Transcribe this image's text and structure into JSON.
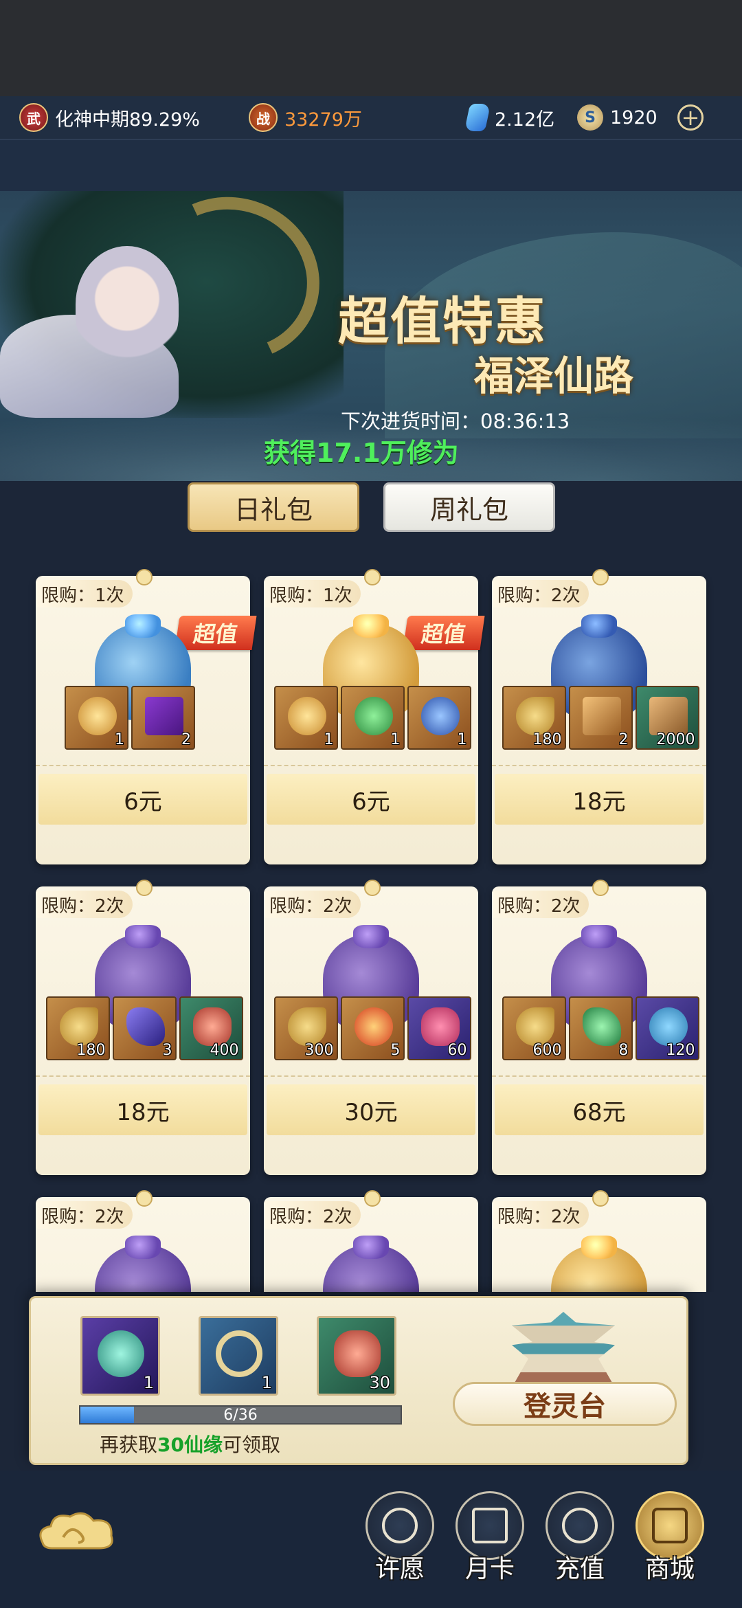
{
  "topbar": {
    "realm_badge": "武",
    "realm": "化神中期89.29%",
    "power_badge": "战",
    "power": "33279万",
    "spirit_stones": "2.12亿",
    "coin_symbol": "S",
    "coins": "1920",
    "add_symbol": "+"
  },
  "banner": {
    "title_line1": "超值特惠",
    "title_line2": "福泽仙路",
    "restock_label": "下次进货时间：",
    "restock_time": "08:36:13",
    "gain_text": "获得17.1万修为"
  },
  "tabs": [
    {
      "label": "日礼包",
      "active": true
    },
    {
      "label": "周礼包",
      "active": false
    }
  ],
  "packs": [
    {
      "limit": "限购：1次",
      "tag": "超值",
      "price": "6元",
      "items": [
        {
          "icon": "gift-bag-icon",
          "count": "1"
        },
        {
          "icon": "talisman-scroll-icon",
          "count": "2"
        }
      ]
    },
    {
      "limit": "限购：1次",
      "tag": "超值",
      "price": "6元",
      "items": [
        {
          "icon": "gift-bag-icon",
          "count": "1"
        },
        {
          "icon": "green-potion-icon",
          "count": "1"
        },
        {
          "icon": "blue-potion-icon",
          "count": "1"
        }
      ]
    },
    {
      "limit": "限购：2次",
      "tag": "",
      "price": "18元",
      "items": [
        {
          "icon": "crescent-token-icon",
          "count": "180"
        },
        {
          "icon": "tablet-icon",
          "count": "2"
        },
        {
          "icon": "scroll-bundle-icon",
          "count": "2000"
        }
      ]
    },
    {
      "limit": "限购：2次",
      "tag": "",
      "price": "18元",
      "items": [
        {
          "icon": "crescent-token-icon",
          "count": "180"
        },
        {
          "icon": "purple-crystal-icon",
          "count": "3"
        },
        {
          "icon": "red-ore-icon",
          "count": "400"
        }
      ]
    },
    {
      "limit": "限购：2次",
      "tag": "",
      "price": "30元",
      "items": [
        {
          "icon": "crescent-token-icon",
          "count": "300"
        },
        {
          "icon": "fire-orb-icon",
          "count": "5"
        },
        {
          "icon": "pouch-icon",
          "count": "60"
        }
      ]
    },
    {
      "limit": "限购：2次",
      "tag": "",
      "price": "68元",
      "items": [
        {
          "icon": "crescent-token-icon",
          "count": "600"
        },
        {
          "icon": "jade-pendant-icon",
          "count": "8"
        },
        {
          "icon": "spirit-beast-icon",
          "count": "120"
        }
      ]
    },
    {
      "limit": "限购：2次",
      "tag": "",
      "price": "",
      "items": []
    },
    {
      "limit": "限购：2次",
      "tag": "",
      "price": "",
      "items": []
    },
    {
      "limit": "限购：2次",
      "tag": "",
      "price": "",
      "items": []
    }
  ],
  "reward_panel": {
    "rewards": [
      {
        "icon": "spirit-pet-icon",
        "count": "1"
      },
      {
        "icon": "jade-ring-icon",
        "count": "1"
      },
      {
        "icon": "red-ore-icon",
        "count": "30"
      }
    ],
    "progress_text": "6/36",
    "progress_fraction": 0.1667,
    "hint_prefix": "再获取",
    "hint_amount": "30仙缘",
    "hint_suffix": "可领取",
    "altar_button": "登灵台"
  },
  "nav": [
    {
      "label": "许愿",
      "active": false
    },
    {
      "label": "月卡",
      "active": false
    },
    {
      "label": "充值",
      "active": false
    },
    {
      "label": "商城",
      "active": true
    }
  ],
  "colors": {
    "accent_gold": "#e9c985",
    "price_gold": "#f2dc9c",
    "gain_green": "#4fef5c",
    "power_orange": "#ff9a3c",
    "hint_green": "#17a12a"
  }
}
